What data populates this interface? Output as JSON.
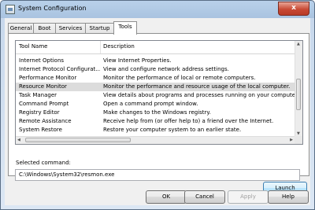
{
  "window": {
    "title": "System Configuration",
    "close_label": "x"
  },
  "tabs": [
    {
      "label": "General"
    },
    {
      "label": "Boot"
    },
    {
      "label": "Services"
    },
    {
      "label": "Startup"
    },
    {
      "label": "Tools",
      "active": true
    }
  ],
  "table": {
    "headers": [
      "Tool Name",
      "Description"
    ],
    "rows": [
      [
        "Internet Options",
        "View Internet Properties."
      ],
      [
        "Internet Protocol Configurat...",
        "View and configure network address settings."
      ],
      [
        "Performance Monitor",
        "Monitor the performance of local or remote computers."
      ],
      [
        "Resource Monitor",
        "Monitor the performance and resource usage of the local computer."
      ],
      [
        "Task Manager",
        "View details about programs and processes running on your computer."
      ],
      [
        "Command Prompt",
        "Open a command prompt window."
      ],
      [
        "Registry Editor",
        "Make changes to the Windows registry."
      ],
      [
        "Remote Assistance",
        "Receive help from (or offer help to) a friend over the Internet."
      ],
      [
        "System Restore",
        "Restore your computer system to an earlier state."
      ]
    ],
    "selected_index": 3
  },
  "selected_command": {
    "label": "Selected command:",
    "value": "C:\\Windows\\System32\\resmon.exe"
  },
  "buttons": {
    "launch": "Launch",
    "ok": "OK",
    "cancel": "Cancel",
    "apply": "Apply",
    "help": "Help"
  },
  "colors": {
    "title_bar": "#b9d1ea",
    "selection": "#dcdcdc",
    "close_button": "#c84a35"
  }
}
